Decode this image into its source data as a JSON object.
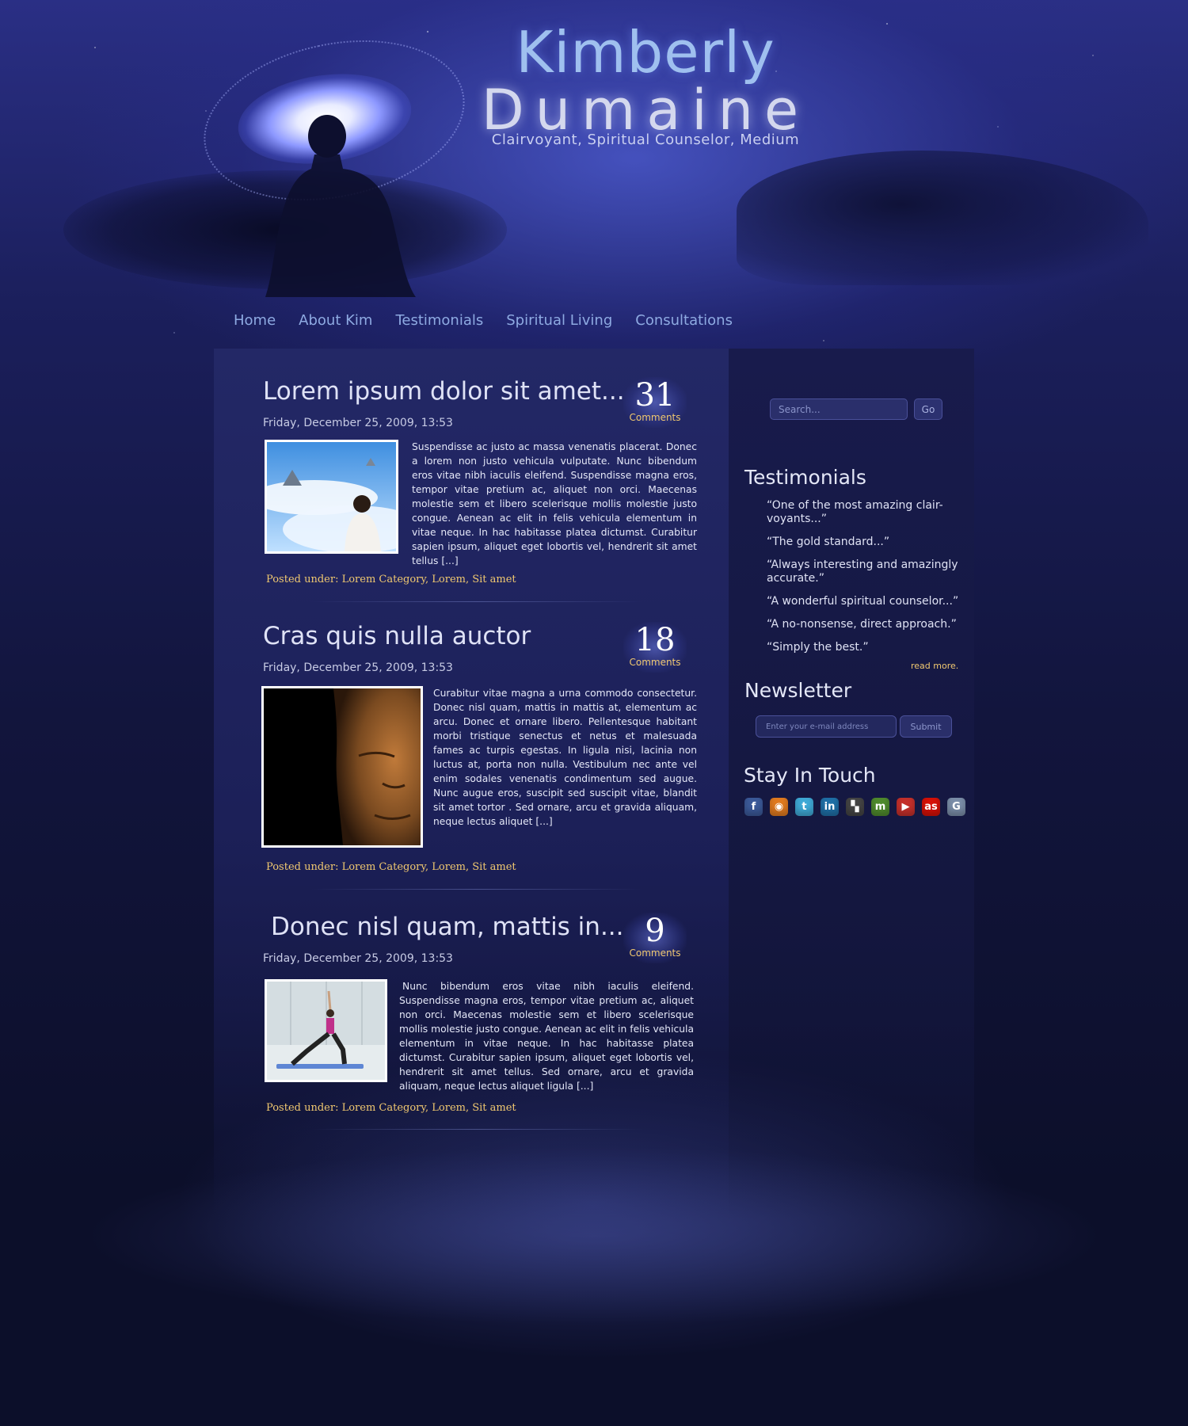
{
  "site": {
    "title_first": "Kimberly",
    "title_last": "Dumaine",
    "tagline": "Clairvoyant, Spiritual Counselor, Medium"
  },
  "nav": {
    "items": [
      {
        "label": "Home"
      },
      {
        "label": "About Kim"
      },
      {
        "label": "Testimonials"
      },
      {
        "label": "Spiritual Living"
      },
      {
        "label": "Consultations"
      }
    ]
  },
  "posts": [
    {
      "title": "Lorem ipsum dolor sit amet...",
      "date": "Friday, December 25, 2009, 13:53",
      "comment_count": "31",
      "comment_label": "Comments",
      "excerpt": "Suspendisse ac justo ac massa venenatis placerat. Donec a lorem non justo vehicula vulputate. Nunc bibendum eros vitae nibh iaculis eleifend. Suspendisse magna eros, tempor vitae pretium ac, aliquet non orci. Maecenas molestie sem et libero scelerisque mollis molestie justo congue. Aenean ac elit in felis vehicula elementum in vitae neque. In hac habitasse platea dictumst. Curabitur sapien ipsum, aliquet eget lobortis vel, hendrerit sit amet tellus [...]",
      "meta_prefix": "Posted under: ",
      "categories": [
        "Lorem Category",
        "Lorem",
        "Sit amet"
      ],
      "thumb": "man-in-clouds"
    },
    {
      "title": "Cras quis nulla auctor",
      "date": "Friday, December 25, 2009, 13:53",
      "comment_count": "18",
      "comment_label": "Comments",
      "excerpt": "Curabitur vitae magna a urna commodo consectetur. Donec nisl quam, mattis in mattis at, elementum ac arcu. Donec et ornare libero. Pellentesque habitant morbi tristique senectus et netus et malesuada fames ac turpis egestas. In ligula nisi, lacinia non luctus at, porta non nulla. Vestibulum nec ante vel enim sodales venenatis condimentum sed augue. Nunc augue eros, suscipit sed suscipit vitae, blandit sit amet tortor . Sed ornare, arcu et gravida aliquam, neque lectus aliquet [...]",
      "meta_prefix": "Posted under: ",
      "categories": [
        "Lorem Category",
        "Lorem",
        "Sit amet"
      ],
      "thumb": "buddha-face"
    },
    {
      "title": "Donec nisl quam, mattis in...",
      "date": "Friday, December 25, 2009, 13:53",
      "comment_count": "9",
      "comment_label": "Comments",
      "excerpt": "Nunc bibendum eros vitae nibh iaculis eleifend. Suspendisse magna eros, tempor vitae pretium ac, aliquet non orci. Maecenas molestie sem et libero scelerisque mollis molestie justo congue. Aenean ac elit in felis vehicula elementum in vitae neque. In hac habitasse platea dictumst. Curabitur sapien ipsum, aliquet eget lobortis vel, hendrerit sit amet tellus. Sed ornare, arcu et gravida aliquam, neque lectus aliquet ligula [...]",
      "meta_prefix": "Posted under: ",
      "categories": [
        "Lorem Category",
        "Lorem",
        "Sit amet"
      ],
      "thumb": "yoga-pose"
    }
  ],
  "sidebar": {
    "search": {
      "placeholder": "Search...",
      "button": "Go"
    },
    "testimonials": {
      "heading": "Testimonials",
      "items": [
        "“One of the most amazing clair-voyants...”",
        "“The gold standard...”",
        "“Always interesting and amazingly accurate.”",
        "“A wonderful spiritual counselor...”",
        "“A no-nonsense, direct approach.”",
        "“Simply the best.”"
      ],
      "read_more": "read more."
    },
    "newsletter": {
      "heading": "Newsletter",
      "placeholder": "Enter your e-mail address",
      "button": "Submit"
    },
    "stay_in_touch": {
      "heading": "Stay In Touch",
      "icons": [
        {
          "name": "facebook-icon",
          "glyph": "f",
          "color": "#3b5998"
        },
        {
          "name": "rss-icon",
          "glyph": "◉",
          "color": "#e07a1f"
        },
        {
          "name": "twitter-icon",
          "glyph": "t",
          "color": "#3fa9d6"
        },
        {
          "name": "linkedin-icon",
          "glyph": "in",
          "color": "#1f6fa6"
        },
        {
          "name": "delicious-icon",
          "glyph": "▚",
          "color": "#444444"
        },
        {
          "name": "myspace-icon",
          "glyph": "m",
          "color": "#4f8a2d"
        },
        {
          "name": "youtube-icon",
          "glyph": "▶",
          "color": "#c4302b"
        },
        {
          "name": "lastfm-icon",
          "glyph": "as",
          "color": "#d51007"
        },
        {
          "name": "google-icon",
          "glyph": "G",
          "color": "#7a8da8"
        }
      ]
    }
  }
}
